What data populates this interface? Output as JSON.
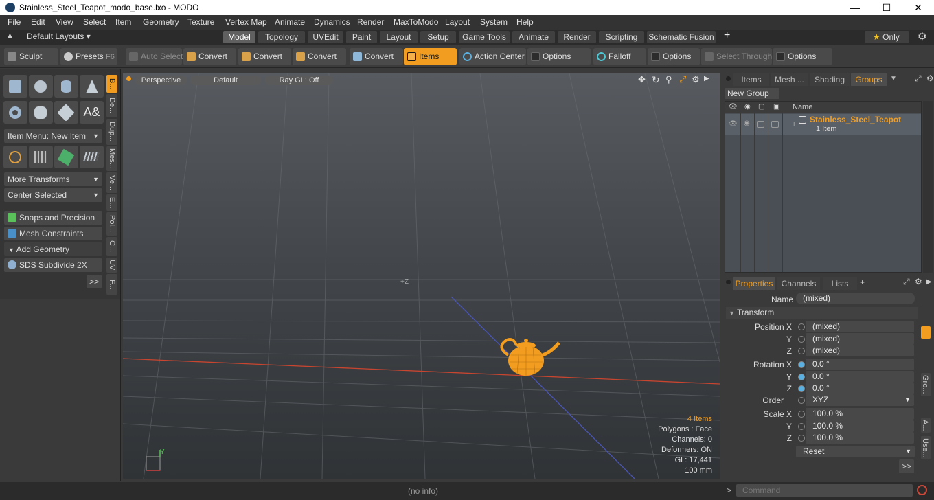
{
  "window": {
    "title": "Stainless_Steel_Teapot_modo_base.lxo - MODO"
  },
  "menubar": [
    "File",
    "Edit",
    "View",
    "Select",
    "Item",
    "Geometry",
    "Texture",
    "Vertex Map",
    "Animate",
    "Dynamics",
    "Render",
    "MaxToModo",
    "Layout",
    "System",
    "Help"
  ],
  "layout_tabs": {
    "layouts_label": "Default Layouts",
    "tabs": [
      "Model",
      "Topology",
      "UVEdit",
      "Paint",
      "Layout",
      "Setup",
      "Game Tools",
      "Animate",
      "Render",
      "Scripting",
      "Schematic Fusion"
    ],
    "active": "Model",
    "add": "+",
    "only_label": "Only"
  },
  "toolbar": {
    "sculpt": "Sculpt",
    "presets": "Presets",
    "presets_key": "F6",
    "auto_select": "Auto Select",
    "convert": "Convert",
    "items": "Items",
    "action_center": "Action Center",
    "options": "Options",
    "falloff": "Falloff",
    "select_through": "Select Through"
  },
  "left_panel": {
    "item_menu": "Item Menu: New Item",
    "more_transforms": "More Transforms",
    "center_selected": "Center Selected",
    "snaps": "Snaps and Precision",
    "mesh_constraints": "Mesh Constraints",
    "add_geometry": "Add Geometry",
    "sds_subdivide": "SDS Subdivide 2X",
    "more": ">>",
    "vtabs": [
      "B...",
      "De...",
      "Dup...",
      "Mes...",
      "Ve...",
      "E...",
      "Pol...",
      "C...",
      "UV",
      "F..."
    ]
  },
  "viewport": {
    "perspective": "Perspective",
    "default": "Default",
    "raygl": "Ray GL: Off",
    "axis_label": "+Z",
    "gizmo_y": "Y",
    "stats": {
      "items": "4 Items",
      "polygons": "Polygons : Face",
      "channels": "Channels: 0",
      "deformers": "Deformers: ON",
      "gl": "GL: 17,441",
      "scale": "100 mm"
    }
  },
  "groups_panel": {
    "tabs": [
      "Items",
      "Mesh ...",
      "Shading",
      "Groups"
    ],
    "active_tab": "Groups",
    "new_group": "New Group",
    "col_name": "Name",
    "group_name": "Stainless_Steel_Teapot",
    "group_count": "1 Item",
    "colors": {
      "accent": "#f29d1f"
    }
  },
  "properties_panel": {
    "tabs": [
      "Properties",
      "Channels",
      "Lists"
    ],
    "active_tab": "Properties",
    "name_label": "Name",
    "name_value": "(mixed)",
    "transform_label": "Transform",
    "position_label": "Position X",
    "y_label": "Y",
    "z_label": "Z",
    "position": [
      "(mixed)",
      "(mixed)",
      "(mixed)"
    ],
    "rotation_label": "Rotation X",
    "rotation": [
      "0.0 °",
      "0.0 °",
      "0.0 °"
    ],
    "order_label": "Order",
    "order_value": "XYZ",
    "scale_label": "Scale X",
    "scale": [
      "100.0 %",
      "100.0 %",
      "100.0 %"
    ],
    "reset": "Reset",
    "more": ">>",
    "side_tabs": [
      "Gro...",
      "A...",
      "Use..."
    ]
  },
  "statusbar": {
    "info": "(no info)",
    "prompt": ">",
    "command_placeholder": "Command"
  }
}
